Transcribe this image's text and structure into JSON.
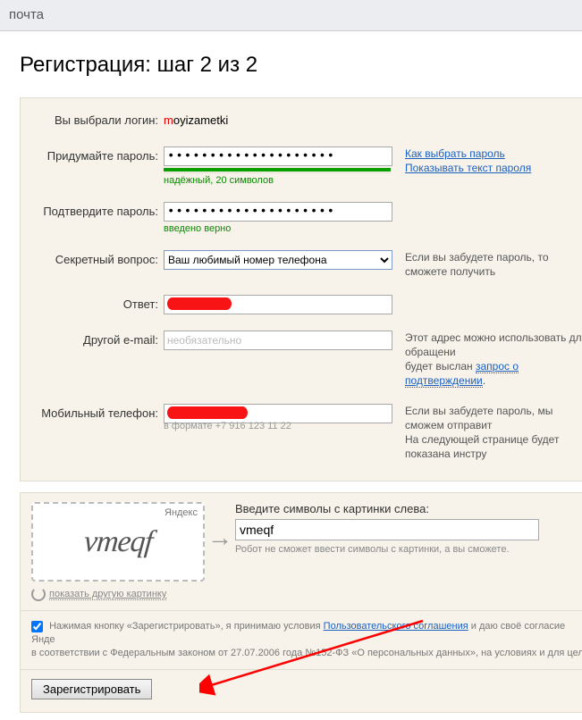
{
  "nav": {
    "item": "Почта"
  },
  "heading": "Регистрация: шаг 2 из 2",
  "form": {
    "login_label": "Вы выбрали логин:",
    "login_value_first": "m",
    "login_value_rest": "oyizametki",
    "password_label": "Придумайте пароль:",
    "password_value": "••••••••••••••••••••",
    "password_strength": "надёжный, 20 символов",
    "password_help1": "Как выбрать пароль",
    "password_help2": "Показывать текст пароля",
    "confirm_label": "Подтвердите пароль:",
    "confirm_value": "••••••••••••••••••••",
    "confirm_ok": "введено верно",
    "secret_q_label": "Секретный вопрос:",
    "secret_q_value": "Ваш любимый номер телефона",
    "secret_q_help": "Если вы забудете пароль, то сможете получить",
    "answer_label": "Ответ:",
    "other_email_label": "Другой e-mail:",
    "other_email_placeholder": "необязательно",
    "other_email_help1": "Этот адрес можно использовать для обращени",
    "other_email_help2a": "будет выслан ",
    "other_email_help2b": "запрос о подтверждении",
    "phone_label": "Мобильный телефон:",
    "phone_format": "в формате +7 916 123 11 22",
    "phone_help1": "Если вы забудете пароль, мы сможем отправит",
    "phone_help2": "На следующей странице будет показана инстру"
  },
  "captcha": {
    "brand": "Яндекс",
    "image_text": "vmeqf",
    "prompt": "Введите символы с картинки слева:",
    "input_value": "vmeqf",
    "note": "Робот не сможет ввести символы с картинки, а вы сможете.",
    "refresh": "показать другую картинку"
  },
  "agreement": {
    "text1": "Нажимая кнопку «Зарегистрировать», я принимаю условия ",
    "link1": "Пользовательского соглашения",
    "text2": " и даю своё согласие Янде",
    "text3": "в соответствии с Федеральным законом от 27.07.2006 года №152-ФЗ «О персональных данных», на условиях и для целе"
  },
  "submit": {
    "label": "Зарегистрировать"
  }
}
